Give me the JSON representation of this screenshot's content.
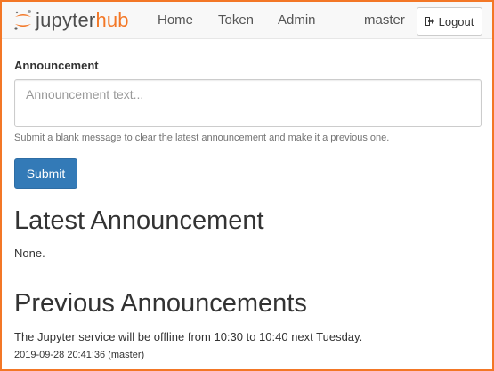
{
  "nav": {
    "logo_word": "jupyter",
    "logo_hub": "hub",
    "links": [
      "Home",
      "Token",
      "Admin"
    ],
    "user": "master",
    "logout_label": "Logout",
    "logout_icon": "sign-out-icon",
    "logo_icon": "jupyter-logo-icon"
  },
  "form": {
    "label": "Announcement",
    "placeholder": "Announcement text...",
    "value": "",
    "help": "Submit a blank message to clear the latest announcement and make it a previous one.",
    "submit_label": "Submit"
  },
  "latest": {
    "heading": "Latest Announcement",
    "text": "None."
  },
  "previous": {
    "heading": "Previous Announcements",
    "items": [
      {
        "text": "The Jupyter service will be offline from 10:30 to 10:40 next Tuesday.",
        "meta": "2019-09-28 20:41:36 (master)"
      }
    ]
  },
  "colors": {
    "accent": "#f37726",
    "primary_button": "#337ab7",
    "navbar_bg": "#f8f8f8"
  }
}
